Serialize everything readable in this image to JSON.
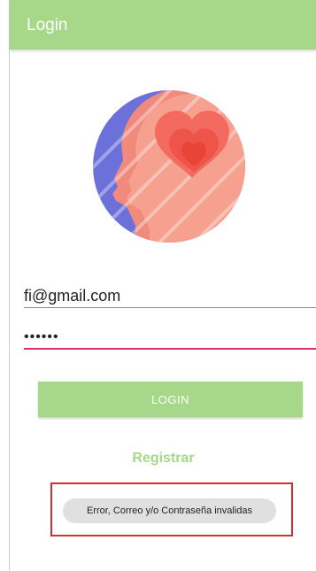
{
  "appbar": {
    "title": "Login",
    "color": "#a7d88a"
  },
  "logo": {
    "icon": "head-heart-icon"
  },
  "form": {
    "email_value": "fi@gmail.com",
    "password_value": "••••••",
    "login_label": "LOGIN",
    "register_label": "Registrar"
  },
  "toast": {
    "message": "Error, Correo y/o Contraseña invalidas"
  },
  "colors": {
    "accent": "#a7d88a",
    "error_box": "#d32f2f",
    "focus_underline": "#d6336c"
  }
}
